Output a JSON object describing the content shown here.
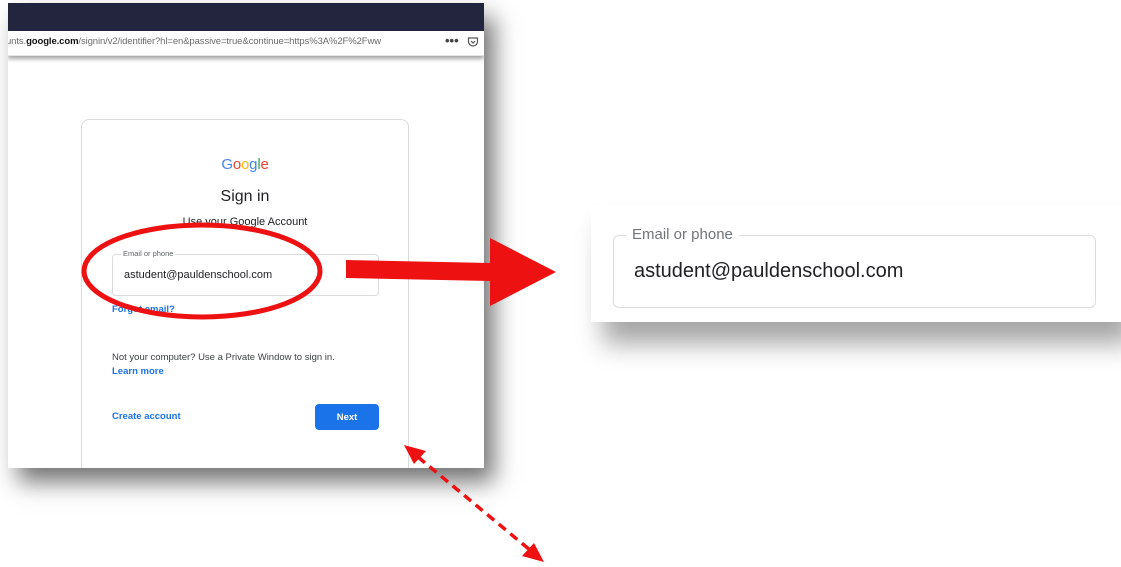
{
  "browser": {
    "url_prefix": "unts.",
    "url_domain": "google.com",
    "url_path": "/signin/v2/identifier?hl=en&passive=true&continue=https%3A%2F%2Fww",
    "more_glyph": "•••"
  },
  "signin": {
    "logo": [
      "G",
      "o",
      "o",
      "g",
      "l",
      "e"
    ],
    "logo_colors": [
      "#4285f4",
      "#ea4335",
      "#fbbc05",
      "#4285f4",
      "#34a853",
      "#ea4335"
    ],
    "title": "Sign in",
    "subtitle": "Use your Google Account",
    "email_label": "Email or phone",
    "email_value": "astudent@pauldenschool.com",
    "forgot_email": "Forgot email?",
    "private_note": "Not your computer? Use a Private Window to sign in.",
    "learn_more": "Learn more",
    "create_account": "Create account",
    "next": "Next",
    "accent": "#1a73e8"
  },
  "zoom": {
    "email_label": "Email or phone",
    "email_value": "astudent@pauldenschool.com"
  },
  "annotations": {
    "highlight_color": "#ee1111"
  }
}
